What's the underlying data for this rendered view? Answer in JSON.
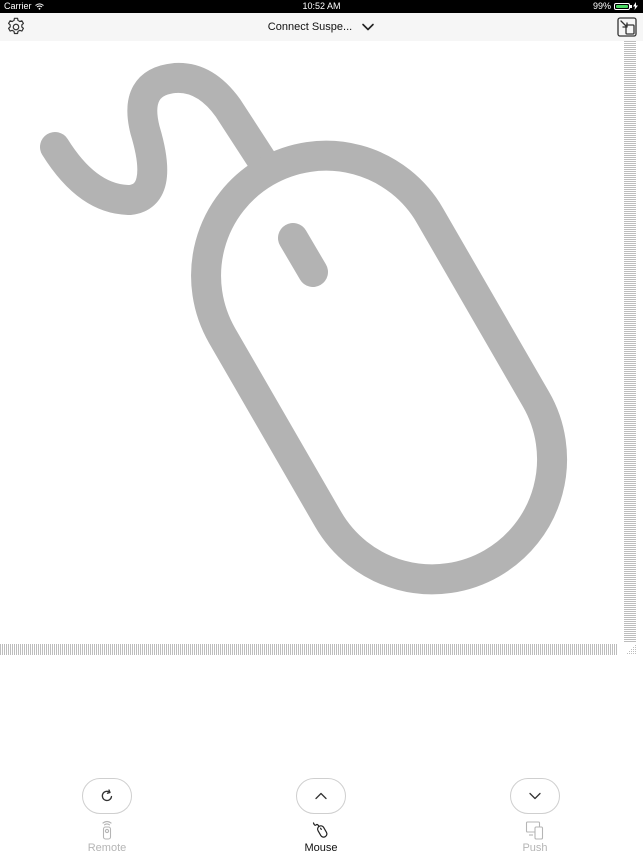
{
  "status_bar": {
    "carrier": "Carrier",
    "time": "10:52 AM",
    "battery": "99%",
    "wifi_icon": "wifi-icon",
    "battery_icon": "battery-icon",
    "charging_icon": "charging-bolt-icon"
  },
  "nav_bar": {
    "title": "Connect Suspe...",
    "settings_icon": "gear-icon",
    "dropdown_icon": "chevron-down-icon",
    "switch_icon": "screen-switch-icon"
  },
  "trackpad": {
    "illustration_icon": "mouse-icon",
    "illustration_color": "#b3b3b3"
  },
  "controls": [
    {
      "name": "refresh",
      "icon": "refresh-icon"
    },
    {
      "name": "scroll-up",
      "icon": "chevron-up-icon"
    },
    {
      "name": "scroll-down",
      "icon": "chevron-down-icon"
    }
  ],
  "tabs": [
    {
      "label": "Remote",
      "icon": "remote-icon",
      "active": false
    },
    {
      "label": "Mouse",
      "icon": "mouse-icon",
      "active": true
    },
    {
      "label": "Push",
      "icon": "devices-icon",
      "active": false
    }
  ],
  "colors": {
    "active_text": "#111111",
    "inactive_text": "#b5b5b5",
    "battery_green": "#4cd964",
    "nav_background": "#f6f6f6"
  }
}
